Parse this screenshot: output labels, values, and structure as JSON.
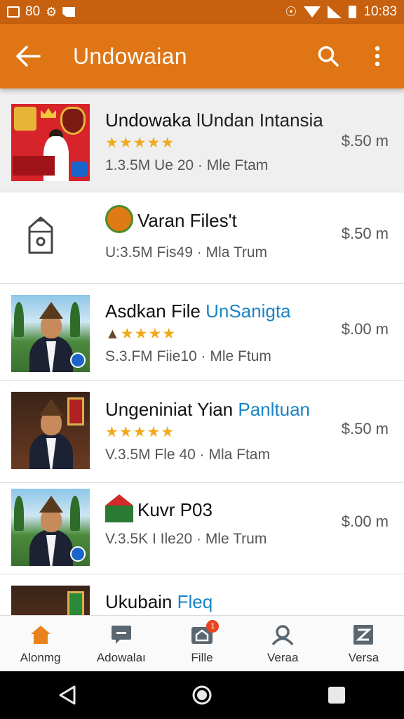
{
  "status_bar": {
    "left_text": "80",
    "time": "10:83"
  },
  "app_bar": {
    "title": "Undowaian"
  },
  "items": [
    {
      "name": "Undowaka",
      "name_accent": " lUndan Intansia",
      "stars": "★★★★★",
      "meta": "1.3.5M  Ue 20 · Mle Ftam",
      "price": "$.50 m"
    },
    {
      "name": "Varan Files't",
      "name_accent": "",
      "stars": "",
      "meta": "U:3.5M  Fis49 · Mla Trum",
      "price": "$.50 m"
    },
    {
      "name": "Asdkan File ",
      "name_accent": "UnSanigta",
      "stars": "★★★★",
      "meta": "S.3.FM  Fiie10 · Mle Ftum",
      "price": "$.00 m"
    },
    {
      "name": "Ungeniniat Yian ",
      "name_accent": "Panltuan",
      "stars": "★★★★★",
      "meta": "V.3.5M  Fle 40 · Mla Ftam",
      "price": "$.50 m"
    },
    {
      "name": "Kuvr P03",
      "name_accent": "",
      "stars": "",
      "meta": "V.3.5K  I Ile20 · Mle Trum",
      "price": "$.00 m"
    },
    {
      "name": "Ukubain ",
      "name_accent": "Fleq",
      "stars": "",
      "meta": "",
      "price": ""
    }
  ],
  "bottom_nav": [
    {
      "label": "Alonmg",
      "icon": "home-icon"
    },
    {
      "label": "Adowalaı",
      "icon": "chat-icon"
    },
    {
      "label": "Fille",
      "icon": "file-icon",
      "badge": "1"
    },
    {
      "label": "Veraa",
      "icon": "person-icon"
    },
    {
      "label": "Versa",
      "icon": "edit-icon"
    }
  ],
  "colors": {
    "accent": "#df7514",
    "statusbar": "#c8610f",
    "star": "#f0a91a",
    "link": "#1a84c4"
  }
}
